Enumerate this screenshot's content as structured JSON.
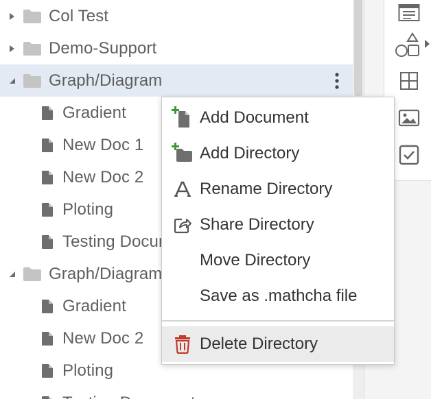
{
  "tree": {
    "items": [
      {
        "label": "Col Test"
      },
      {
        "label": "Demo-Support"
      },
      {
        "label": "Graph/Diagram"
      },
      {
        "label": "Gradient"
      },
      {
        "label": "New Doc 1"
      },
      {
        "label": "New Doc 2"
      },
      {
        "label": "Ploting"
      },
      {
        "label": "Testing Document"
      },
      {
        "label": "Graph/Diagram"
      },
      {
        "label": "Gradient"
      },
      {
        "label": "New Doc 2"
      },
      {
        "label": "Ploting"
      },
      {
        "label": "Testing Document"
      }
    ]
  },
  "context_menu": {
    "items": [
      {
        "label": "Add Document",
        "icon": "add-document-icon"
      },
      {
        "label": "Add Directory",
        "icon": "add-directory-icon"
      },
      {
        "label": "Rename Directory",
        "icon": "rename-icon"
      },
      {
        "label": "Share Directory",
        "icon": "share-icon"
      },
      {
        "label": "Move Directory",
        "icon": ""
      },
      {
        "label": "Save as .mathcha file",
        "icon": ""
      },
      {
        "label": "Delete Directory",
        "icon": "trash-icon"
      }
    ]
  },
  "toolbar": {
    "tools": [
      "text-block-icon",
      "shapes-icon",
      "table-icon",
      "image-icon",
      "checkbox-icon"
    ]
  },
  "colors": {
    "selected_row": "#e4eaf4",
    "icon_gray": "#6a6a6a",
    "add_green": "#3a9a3a",
    "delete_red": "#c0392b",
    "menu_hover": "#ebebeb"
  }
}
